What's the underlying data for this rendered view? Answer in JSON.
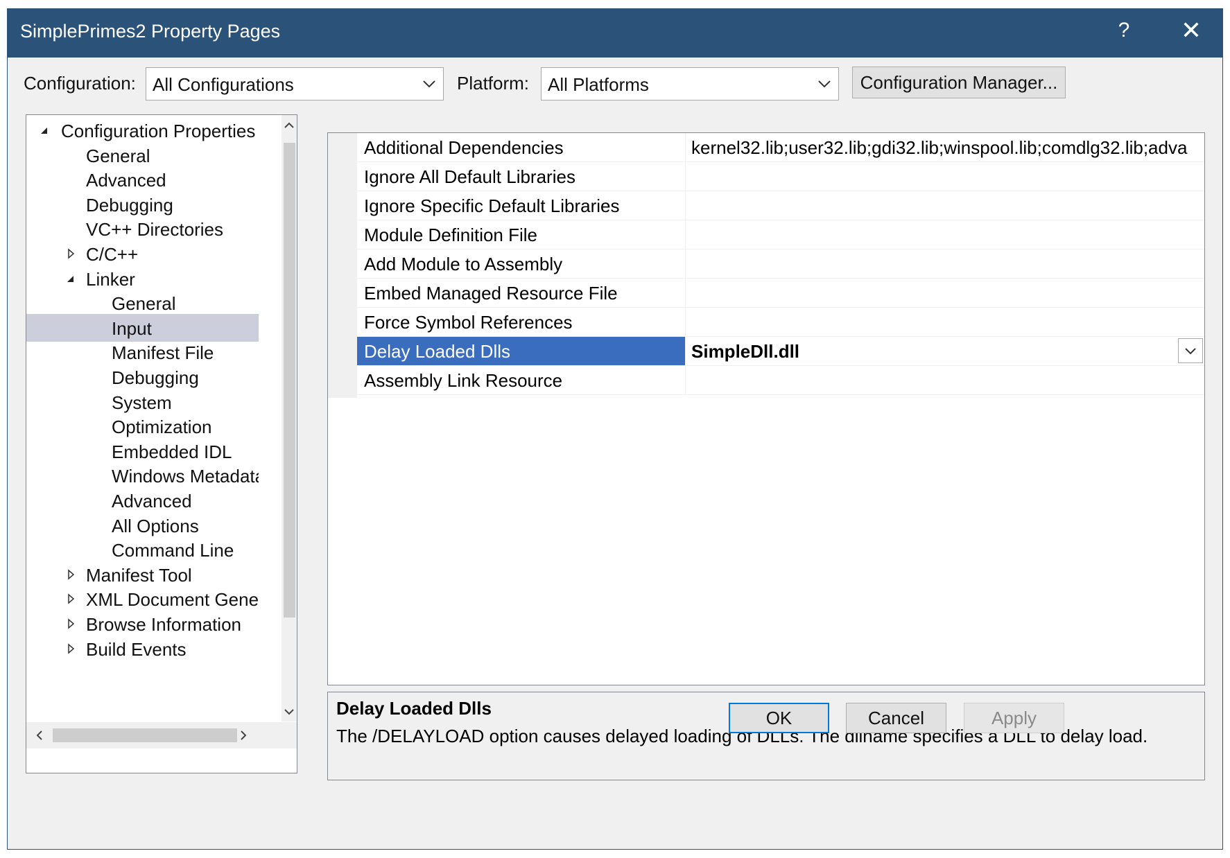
{
  "window": {
    "title": "SimplePrimes2 Property Pages",
    "help_glyph": "?",
    "close_glyph": "✕"
  },
  "toolbar": {
    "configuration_label": "Configuration:",
    "configuration_value": "All Configurations",
    "platform_label": "Platform:",
    "platform_value": "All Platforms",
    "config_manager_label": "Configuration Manager..."
  },
  "tree": {
    "items": [
      {
        "label": "Configuration Properties",
        "expander": "expanded"
      },
      {
        "label": "General"
      },
      {
        "label": "Advanced"
      },
      {
        "label": "Debugging"
      },
      {
        "label": "VC++ Directories"
      },
      {
        "label": "C/C++",
        "expander": "collapsed"
      },
      {
        "label": "Linker",
        "expander": "expanded"
      },
      {
        "label": "General"
      },
      {
        "label": "Input",
        "selected": true
      },
      {
        "label": "Manifest File"
      },
      {
        "label": "Debugging"
      },
      {
        "label": "System"
      },
      {
        "label": "Optimization"
      },
      {
        "label": "Embedded IDL"
      },
      {
        "label": "Windows Metadata"
      },
      {
        "label": "Advanced"
      },
      {
        "label": "All Options"
      },
      {
        "label": "Command Line"
      },
      {
        "label": "Manifest Tool",
        "expander": "collapsed"
      },
      {
        "label": "XML Document Generator",
        "expander": "collapsed"
      },
      {
        "label": "Browse Information",
        "expander": "collapsed"
      },
      {
        "label": "Build Events",
        "expander": "collapsed"
      }
    ],
    "scroll_up_glyph": "⌃",
    "scroll_down_glyph": "⌄",
    "scroll_left_glyph": "<",
    "scroll_right_glyph": ">"
  },
  "properties": {
    "rows": [
      {
        "name": "Additional Dependencies",
        "value": "kernel32.lib;user32.lib;gdi32.lib;winspool.lib;comdlg32.lib;adva"
      },
      {
        "name": "Ignore All Default Libraries",
        "value": ""
      },
      {
        "name": "Ignore Specific Default Libraries",
        "value": ""
      },
      {
        "name": "Module Definition File",
        "value": ""
      },
      {
        "name": "Add Module to Assembly",
        "value": ""
      },
      {
        "name": "Embed Managed Resource File",
        "value": ""
      },
      {
        "name": "Force Symbol References",
        "value": ""
      },
      {
        "name": "Delay Loaded Dlls",
        "value": "SimpleDll.dll",
        "selected": true
      },
      {
        "name": "Assembly Link Resource",
        "value": ""
      }
    ]
  },
  "description": {
    "title": "Delay Loaded Dlls",
    "text": "The /DELAYLOAD option causes delayed loading of DLLs. The dllname specifies a DLL to delay load."
  },
  "buttons": {
    "ok": "OK",
    "cancel": "Cancel",
    "apply": "Apply"
  },
  "colors": {
    "title_bar": "#2b5279",
    "selection_row": "#3b6dbf",
    "tree_selection": "#cccedb",
    "dialog_bg": "#f0f0f0"
  }
}
